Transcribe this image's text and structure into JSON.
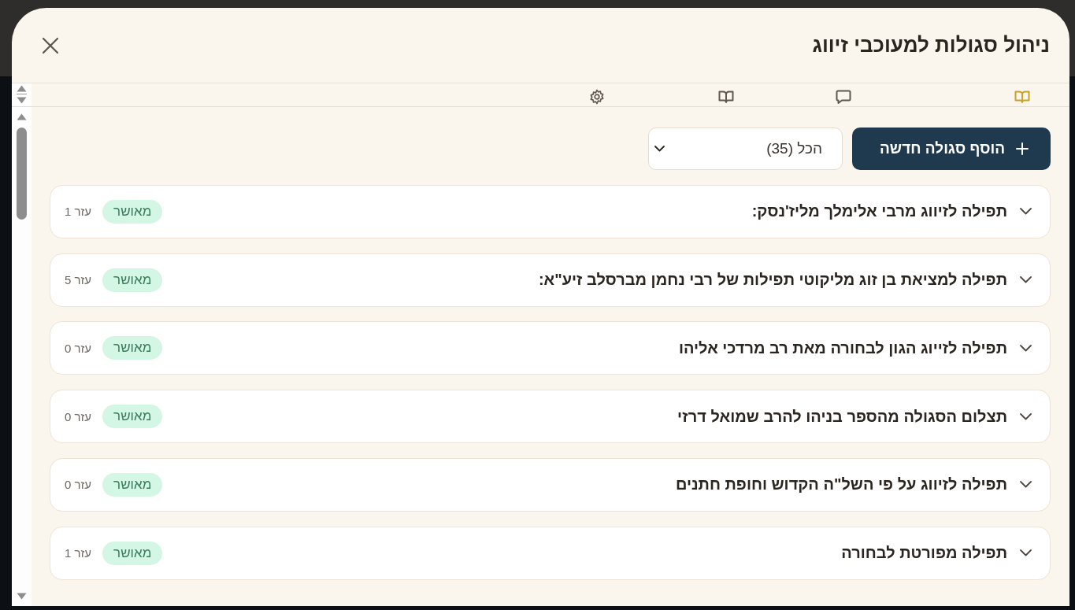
{
  "dialog": {
    "title": "ניהול סגולות למעוכבי זיווג"
  },
  "tabs": [
    {
      "kind": "book",
      "selected": true
    },
    {
      "kind": "chat",
      "selected": false
    },
    {
      "kind": "book",
      "selected": false
    },
    {
      "kind": "gear",
      "selected": false
    }
  ],
  "toolbar": {
    "filter": {
      "value": "הכל (35)"
    },
    "add_button": {
      "label": "הוסף סגולה חדשה"
    }
  },
  "items": [
    {
      "title": "תפילה לזיווג מרבי אלימלך מליז'נסק:",
      "expanded": false,
      "status": {
        "label": "מאושר",
        "kind": "approved"
      },
      "count": "עזר 1"
    },
    {
      "title": "תפילה למציאת בן זוג מליקוטי תפילות של רבי נחמן מברסלב זיע\"א:",
      "expanded": false,
      "status": {
        "label": "מאושר",
        "kind": "approved"
      },
      "count": "עזר 5"
    },
    {
      "title": "תפילה לזייוג הגון לבחורה מאת רב מרדכי אליהו",
      "expanded": false,
      "status": {
        "label": "מאושר",
        "kind": "approved"
      },
      "count": "עזר 0"
    },
    {
      "title": "תצלום הסגולה מהספר בניהו להרב שמואל דרזי",
      "expanded": false,
      "status": {
        "label": "מאושר",
        "kind": "approved"
      },
      "count": "עזר 0"
    },
    {
      "title": "תפילה לזיווג על פי השל\"ה הקדוש וחופת חתנים",
      "expanded": false,
      "status": {
        "label": "מאושר",
        "kind": "approved"
      },
      "count": "עזר 0"
    },
    {
      "title": "תפילה מפורטת לבחורה",
      "expanded": false,
      "status": {
        "label": "מאושר",
        "kind": "approved"
      },
      "count": "עזר 1"
    }
  ]
}
